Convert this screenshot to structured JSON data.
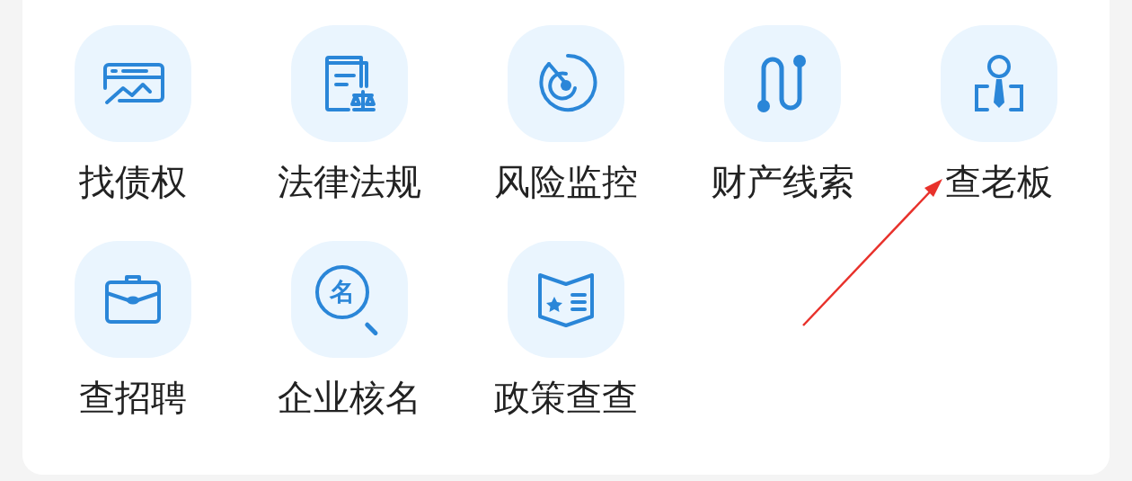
{
  "shortcuts": [
    {
      "label": "找债权",
      "kind": "chart-card"
    },
    {
      "label": "法律法规",
      "kind": "law-book"
    },
    {
      "label": "风险监控",
      "kind": "radar"
    },
    {
      "label": "财产线索",
      "kind": "route"
    },
    {
      "label": "查老板",
      "kind": "boss"
    },
    {
      "label": "查招聘",
      "kind": "briefcase"
    },
    {
      "label": "企业核名",
      "kind": "name-search",
      "icon_text": "名"
    },
    {
      "label": "政策查查",
      "kind": "policy-book"
    }
  ]
}
